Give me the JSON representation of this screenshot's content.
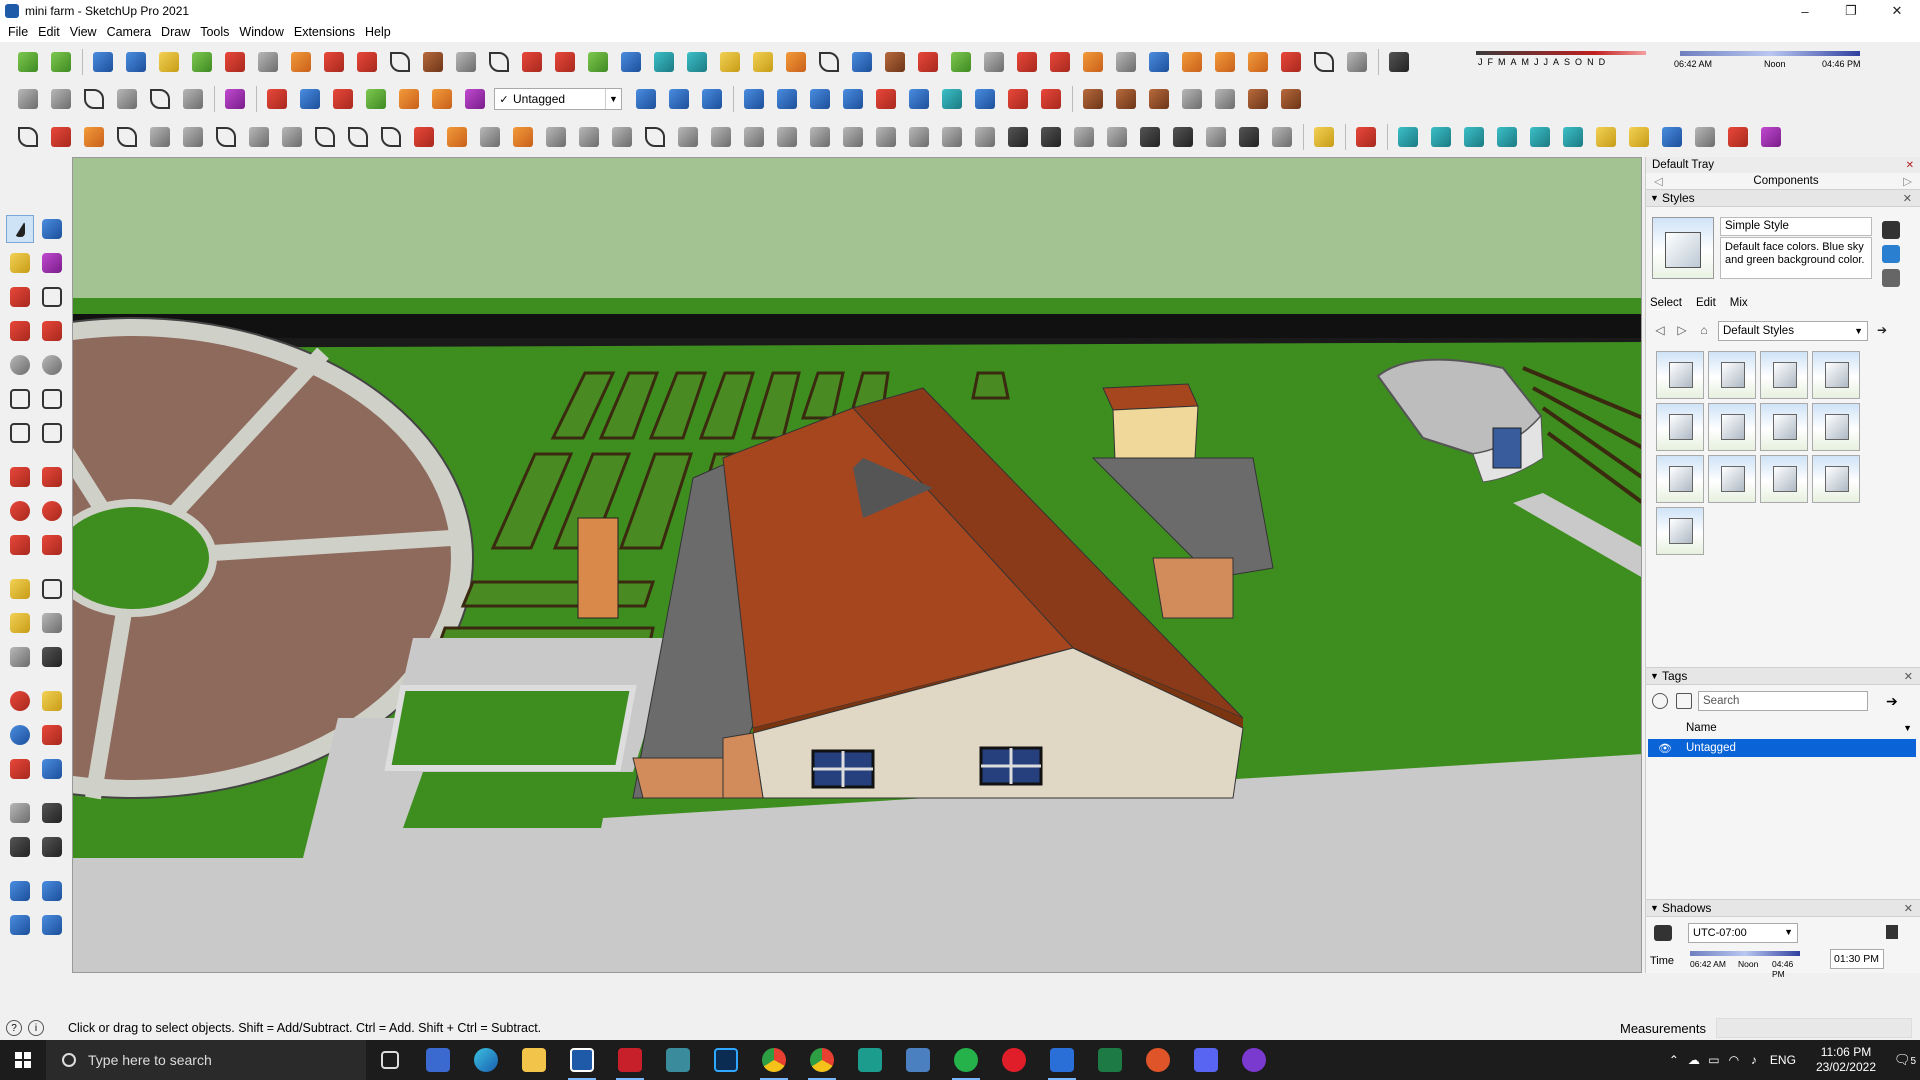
{
  "window": {
    "title": "mini farm - SketchUp Pro 2021",
    "minimize": "–",
    "maximize": "❐",
    "close": "✕"
  },
  "menu": [
    "File",
    "Edit",
    "View",
    "Camera",
    "Draw",
    "Tools",
    "Window",
    "Extensions",
    "Help"
  ],
  "toolbar": {
    "tag_dropdown": {
      "check": "✓",
      "value": "Untagged"
    },
    "month_labels": [
      "J",
      "F",
      "M",
      "A",
      "M",
      "J",
      "J",
      "A",
      "S",
      "O",
      "N",
      "D"
    ],
    "time_labels": {
      "start": "06:42 AM",
      "mid": "Noon",
      "end": "04:46 PM"
    }
  },
  "tray": {
    "title": "Default Tray",
    "components_label": "Components",
    "styles": {
      "header": "Styles",
      "style_name": "Simple Style",
      "description": "Default face colors. Blue sky and green background color.",
      "tabs": [
        "Select",
        "Edit",
        "Mix"
      ],
      "library": "Default Styles"
    },
    "tags": {
      "header": "Tags",
      "search_placeholder": "Search",
      "column_name": "Name",
      "rows": [
        "Untagged"
      ]
    },
    "shadows": {
      "header": "Shadows",
      "timezone": "UTC-07:00",
      "time_label": "Time",
      "slider_labels": {
        "start": "06:42 AM",
        "mid": "Noon",
        "end": "04:46 PM"
      },
      "time_value": "01:30 PM"
    }
  },
  "status": {
    "hint": "Click or drag to select objects. Shift = Add/Subtract. Ctrl = Add. Shift + Ctrl = Subtract.",
    "measurements_label": "Measurements"
  },
  "taskbar": {
    "search_placeholder": "Type here to search",
    "language": "ENG",
    "time": "11:06 PM",
    "date": "23/02/2022",
    "notification_count": "5"
  },
  "colors": {
    "sky": "#a4c392",
    "ground": "#3e8e1f",
    "roof": "#a5461f",
    "wall": "#e0d7c5",
    "path": "#c9c9c9",
    "selection": "#0a64d8"
  }
}
